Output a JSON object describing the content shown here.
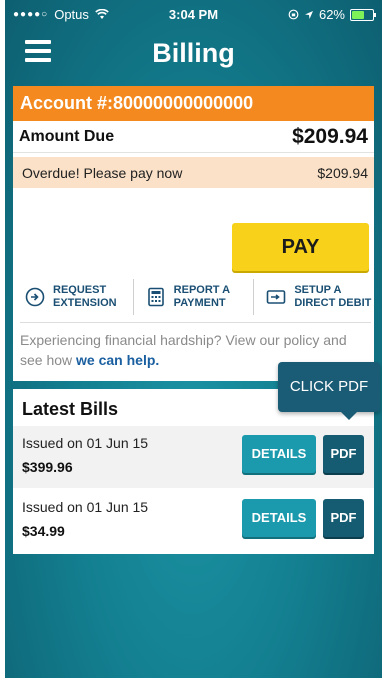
{
  "status_bar": {
    "carrier": "Optus",
    "time": "3:04 PM",
    "battery": "62%",
    "battery_level": 0.62
  },
  "header": {
    "title": "Billing",
    "menu_icon": "hamburger-menu-icon"
  },
  "account": {
    "account_label": "Account #:80000000000000",
    "amount_due_label": "Amount Due",
    "amount_due_value": "$209.94",
    "overdue_text": "Overdue! Please pay now",
    "overdue_value": "$209.94",
    "pay_label": "PAY",
    "actions": [
      {
        "line1": "REQUEST",
        "line2": "EXTENSION",
        "icon": "clock-arrow-icon"
      },
      {
        "line1": "REPORT A",
        "line2": "PAYMENT",
        "icon": "calculator-icon"
      },
      {
        "line1": "SETUP A",
        "line2": "DIRECT DEBIT",
        "icon": "card-arrow-icon"
      }
    ],
    "hardship_text": "Experiencing financial hardship? View our policy and see how ",
    "hardship_link": "we can help."
  },
  "bills": {
    "title": "Latest Bills",
    "details_label": "DETAILS",
    "pdf_label": "PDF",
    "items": [
      {
        "date": "Issued on 01 Jun 15",
        "amount": "$399.96"
      },
      {
        "date": "Issued on 01 Jun 15",
        "amount": "$34.99"
      }
    ]
  },
  "tooltip": {
    "text": "CLICK PDF"
  },
  "colors": {
    "teal_background": "#137f90",
    "orange_bar": "#f48a1f",
    "overdue_bg": "#fbe1c7",
    "pay_yellow": "#f8d21a",
    "details_teal": "#1a9aac",
    "pdf_navy": "#155c72",
    "link_blue": "#1a5fa0"
  }
}
